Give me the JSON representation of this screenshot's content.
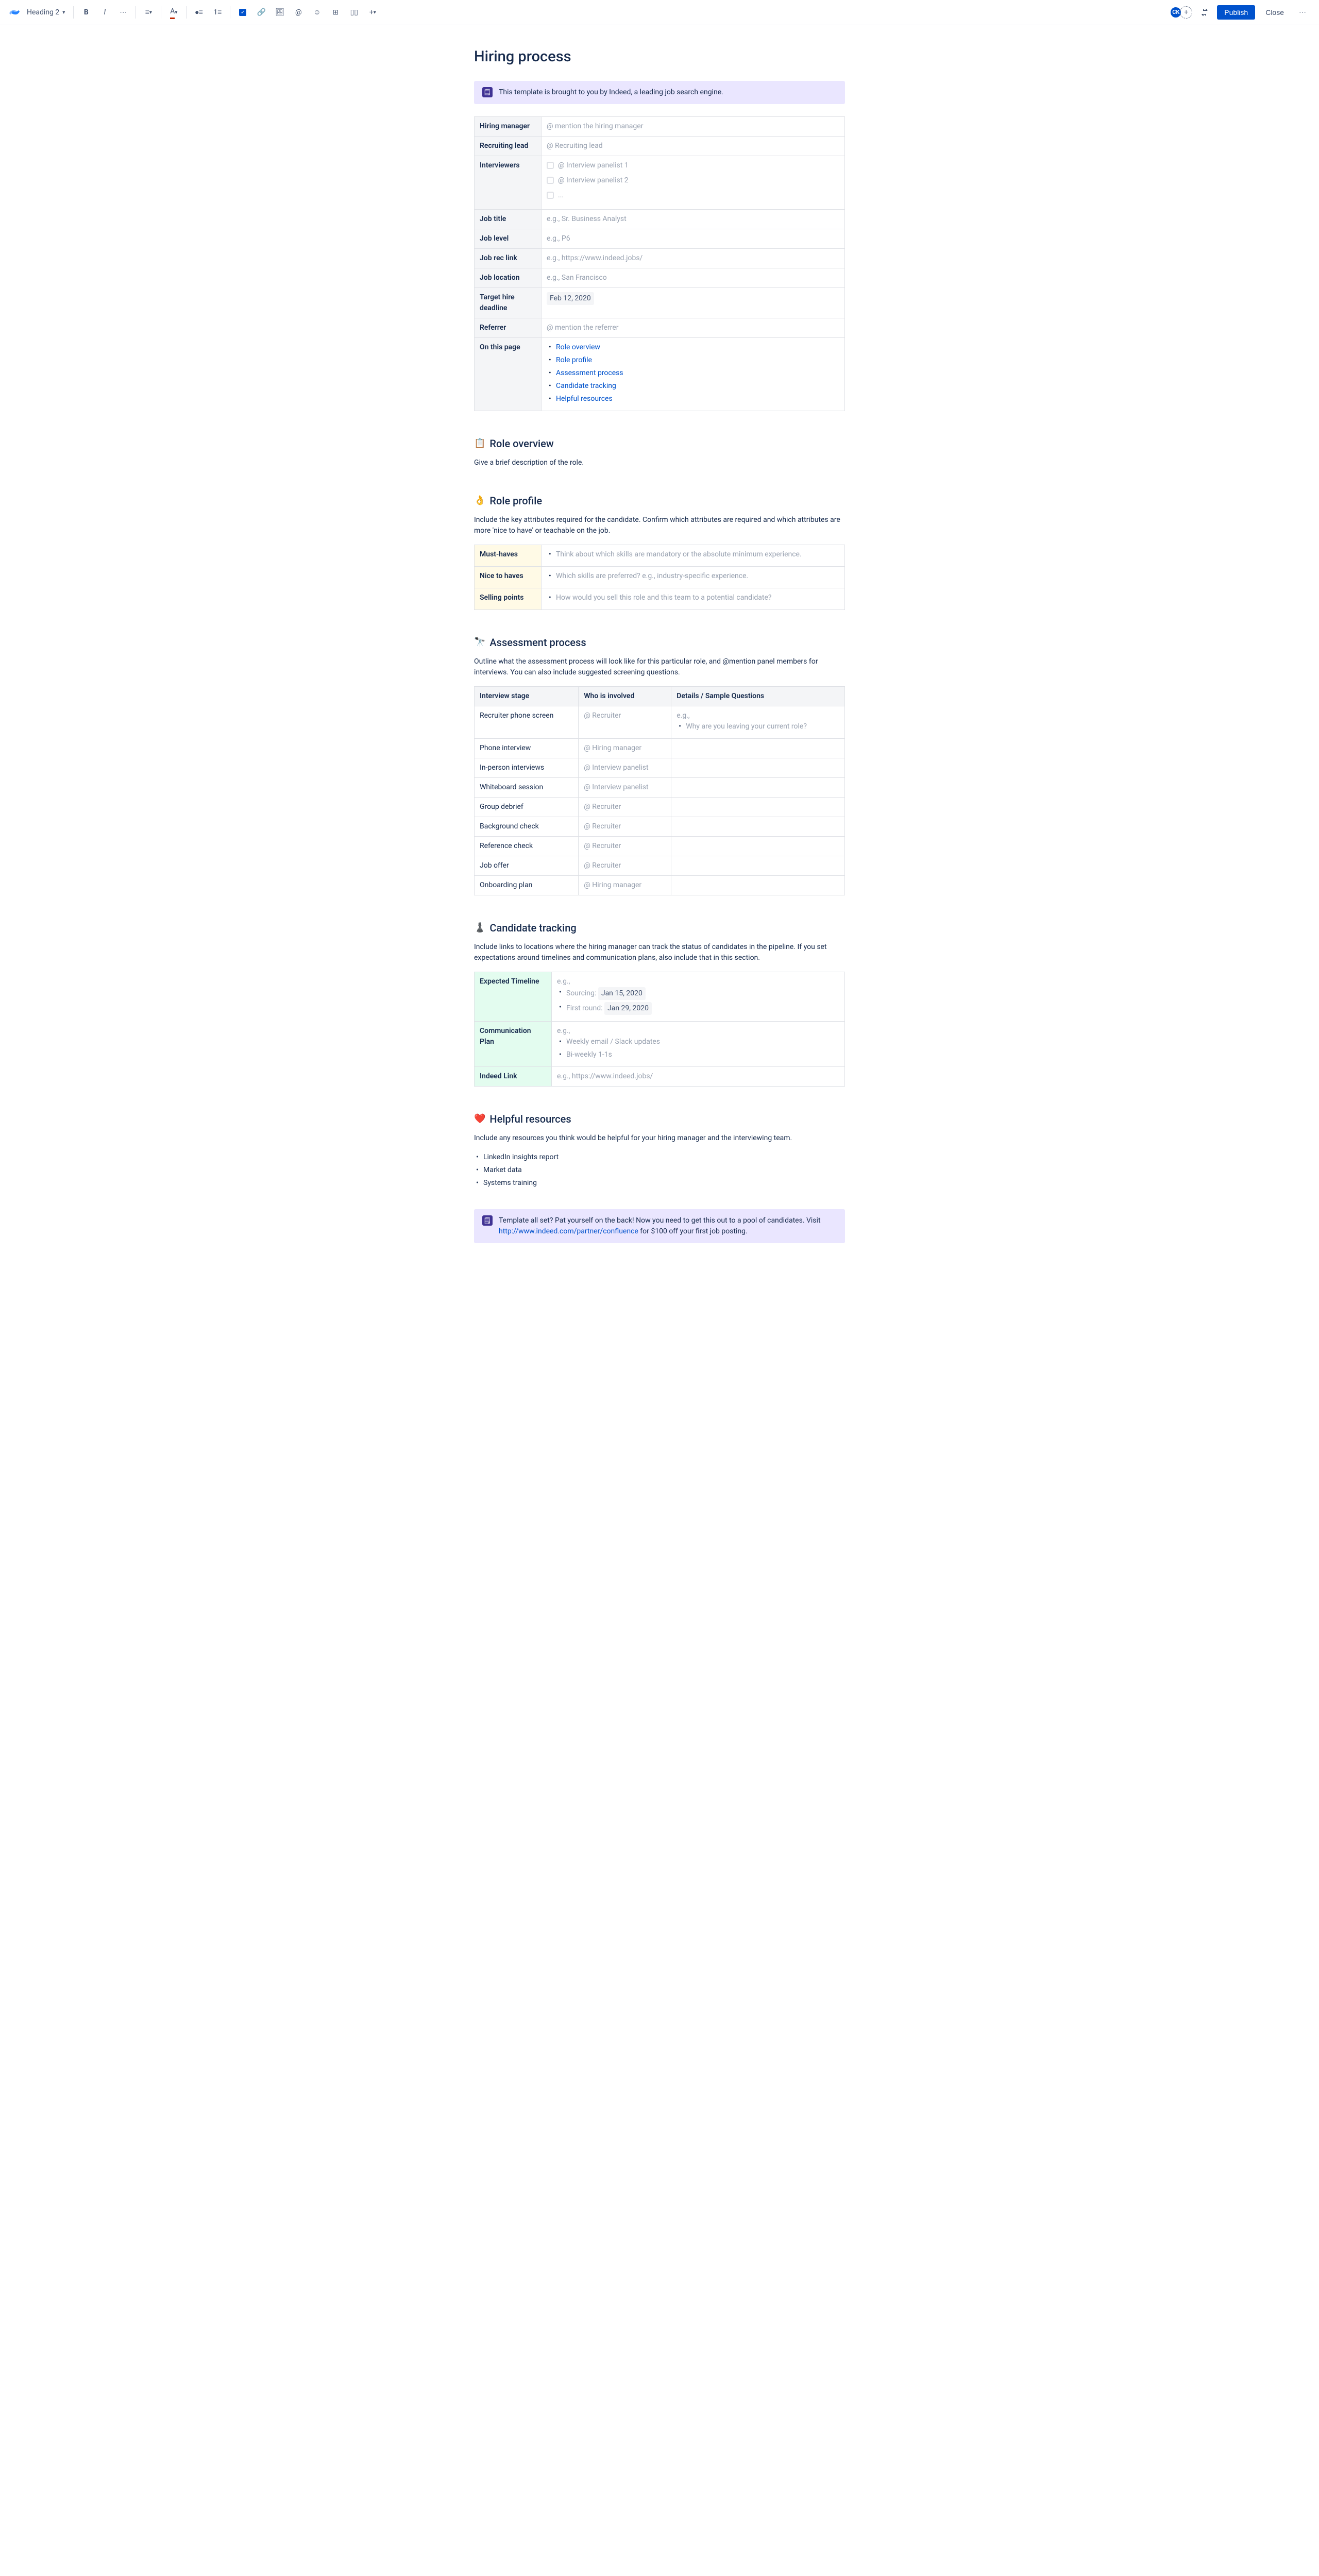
{
  "toolbar": {
    "style_label": "Heading 2",
    "avatar_initials": "CK",
    "publish_label": "Publish",
    "close_label": "Close"
  },
  "title": "Hiring process",
  "top_panel": "This template is brought to you by Indeed, a leading job search engine.",
  "info_table": {
    "hiring_manager": {
      "label": "Hiring manager",
      "placeholder": "@ mention the hiring manager"
    },
    "recruiting_lead": {
      "label": "Recruiting lead",
      "placeholder": "@ Recruiting lead"
    },
    "interviewers": {
      "label": "Interviewers",
      "items": [
        "@ Interview panelist 1",
        "@ Interview panelist 2",
        "..."
      ]
    },
    "job_title": {
      "label": "Job title",
      "placeholder": "e.g., Sr. Business Analyst"
    },
    "job_level": {
      "label": "Job level",
      "placeholder": "e.g., P6"
    },
    "job_rec_link": {
      "label": "Job rec link",
      "placeholder": "e.g., https://www.indeed.jobs/"
    },
    "job_location": {
      "label": "Job location",
      "placeholder": "e.g., San Francisco"
    },
    "target_hire": {
      "label": "Target hire deadline",
      "value": "Feb 12, 2020"
    },
    "referrer": {
      "label": "Referrer",
      "placeholder": "@ mention the referrer"
    },
    "on_this_page": {
      "label": "On this page",
      "links": [
        "Role overview",
        "Role profile",
        "Assessment process",
        "Candidate tracking",
        "Helpful resources"
      ]
    }
  },
  "role_overview": {
    "heading": "Role overview",
    "body": "Give a brief description of the role."
  },
  "role_profile": {
    "heading": "Role profile",
    "body": "Include the key attributes required for the candidate. Confirm which attributes are required and which attributes are more 'nice to have' or teachable on the job.",
    "rows": [
      {
        "label": "Must-haves",
        "text": "Think about which skills are mandatory or the absolute minimum experience."
      },
      {
        "label": "Nice to haves",
        "text": "Which skills are preferred? e.g., industry-specific experience."
      },
      {
        "label": "Selling points",
        "text": "How would you sell this role and this team to a potential candidate?"
      }
    ]
  },
  "assessment": {
    "heading": "Assessment process",
    "body": "Outline what the assessment process will look like for this particular role, and @mention panel members for interviews. You can also include suggested screening questions.",
    "headers": [
      "Interview stage",
      "Who is involved",
      "Details / Sample Questions"
    ],
    "rows": [
      {
        "stage": "Recruiter phone screen",
        "who": "@ Recruiter",
        "eg": "e.g.,",
        "bullet": "Why are you leaving your current role?"
      },
      {
        "stage": "Phone interview",
        "who": "@ Hiring manager"
      },
      {
        "stage": "In-person interviews",
        "who": "@ Interview panelist"
      },
      {
        "stage": "Whiteboard session",
        "who": "@ Interview panelist"
      },
      {
        "stage": "Group debrief",
        "who": "@ Recruiter"
      },
      {
        "stage": "Background check",
        "who": "@ Recruiter"
      },
      {
        "stage": "Reference check",
        "who": "@ Recruiter"
      },
      {
        "stage": "Job offer",
        "who": "@ Recruiter"
      },
      {
        "stage": "Onboarding plan",
        "who": "@ Hiring manager"
      }
    ]
  },
  "tracking": {
    "heading": "Candidate tracking",
    "body": "Include links to locations where the hiring manager can track the status of candidates in the pipeline. If you set expectations around timelines and communication plans, also include that in this section.",
    "timeline": {
      "label": "Expected Timeline",
      "eg": "e.g.,",
      "sourcing_label": "Sourcing:",
      "sourcing_date": "Jan 15, 2020",
      "round_label": "First round:",
      "round_date": "Jan 29, 2020"
    },
    "comm": {
      "label": "Communication Plan",
      "eg": "e.g.,",
      "items": [
        "Weekly email / Slack updates",
        "Bi-weekly 1-1s"
      ]
    },
    "indeed": {
      "label": "Indeed Link",
      "placeholder": "e.g., https://www.indeed.jobs/"
    }
  },
  "resources": {
    "heading": "Helpful resources",
    "body": "Include any resources you think would be helpful for your hiring manager and the interviewing team.",
    "items": [
      "LinkedIn insights report",
      "Market data",
      "Systems training"
    ]
  },
  "bottom_panel": {
    "pre": "Template all set? Pat yourself on the back! Now you need to get this out to a pool of candidates. Visit ",
    "link": "http://www.indeed.com/partner/confluence",
    "post": " for $100 off your first job posting."
  }
}
